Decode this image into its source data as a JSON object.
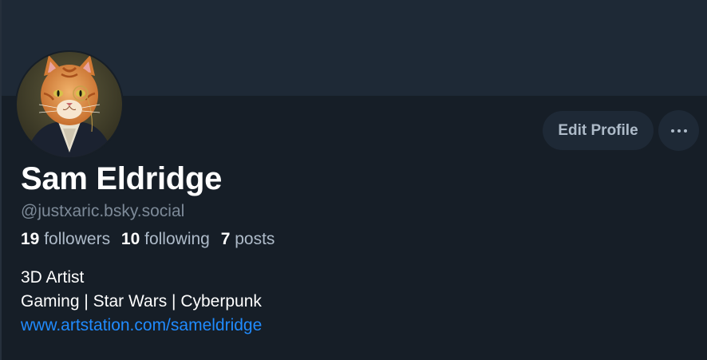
{
  "profile": {
    "display_name": "Sam Eldridge",
    "handle": "@justxaric.bsky.social",
    "avatar_description": "cat-portrait-avatar"
  },
  "stats": {
    "followers_count": "19",
    "followers_label": "followers",
    "following_count": "10",
    "following_label": "following",
    "posts_count": "7",
    "posts_label": "posts"
  },
  "bio": {
    "line1": "3D Artist",
    "line2": "Gaming | Star Wars | Cyberpunk",
    "link": "www.artstation.com/sameldridge"
  },
  "actions": {
    "edit_profile_label": "Edit Profile",
    "more_icon": "ellipsis-icon"
  },
  "colors": {
    "background": "#161e27",
    "banner": "#1e2936",
    "link": "#208bfe",
    "muted_text": "#7d8a98"
  }
}
